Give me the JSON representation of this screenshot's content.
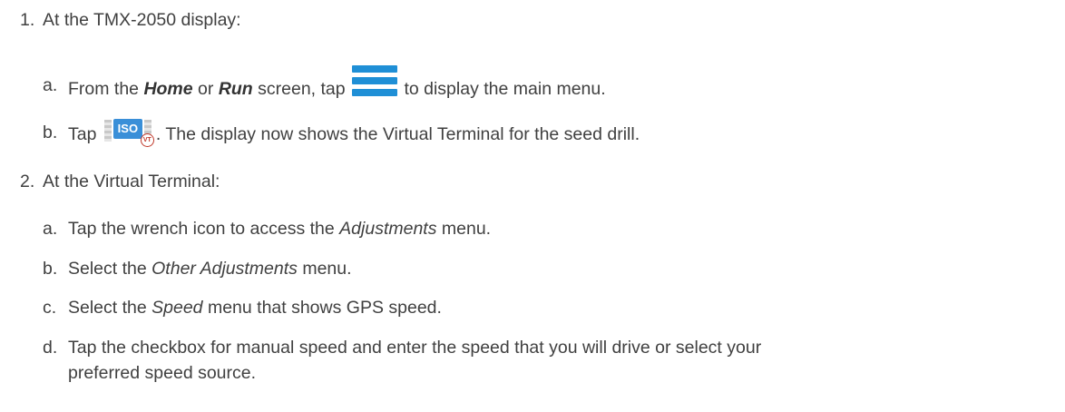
{
  "steps": [
    {
      "number": "1.",
      "text": "At the TMX-2050 display:",
      "substeps": [
        {
          "letter": "a.",
          "pre": "From the ",
          "home": "Home",
          "or": " or ",
          "run": "Run",
          "mid": " screen, tap ",
          "icon": "main-menu-icon",
          "post": " to display the main menu."
        },
        {
          "letter": "b.",
          "pre": "Tap ",
          "icon": "iso-vt-icon",
          "icon_text": "ISO",
          "icon_badge": "VT",
          "post": ". The display now shows the Virtual Terminal for the seed drill."
        }
      ]
    },
    {
      "number": "2.",
      "text": "At the Virtual Terminal:",
      "substeps": [
        {
          "letter": "a.",
          "pre": "Tap the wrench icon to access the ",
          "em": "Adjustments",
          "post": " menu."
        },
        {
          "letter": "b.",
          "pre": "Select the ",
          "em": "Other Adjustments",
          "post": " menu."
        },
        {
          "letter": "c.",
          "pre": "Select the ",
          "em": "Speed",
          "post": " menu that shows GPS speed."
        },
        {
          "letter": "d.",
          "line1": "Tap the checkbox for manual speed and enter the speed that you will drive or select your",
          "line2": "preferred speed source."
        }
      ]
    }
  ]
}
